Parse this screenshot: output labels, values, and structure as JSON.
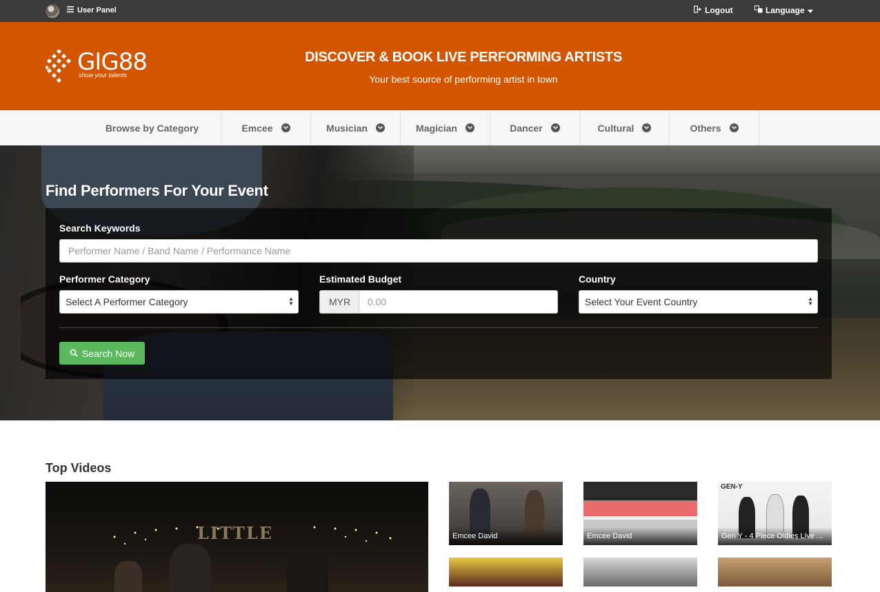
{
  "topbar": {
    "user_panel": "User Panel",
    "logout": "Logout",
    "language": "Language"
  },
  "header": {
    "logo_text": "GIG88",
    "logo_tagline": "show your talents",
    "title": "DISCOVER & BOOK LIVE PERFORMING ARTISTS",
    "subtitle": "Your best source of performing artist in town"
  },
  "nav": {
    "items": [
      {
        "label": "Browse by Category"
      },
      {
        "label": "Emcee"
      },
      {
        "label": "Musician"
      },
      {
        "label": "Magician"
      },
      {
        "label": "Dancer"
      },
      {
        "label": "Cultural"
      },
      {
        "label": "Others"
      }
    ]
  },
  "search": {
    "title": "Find Performers For Your Event",
    "keywords_label": "Search Keywords",
    "keywords_placeholder": "Performer Name / Band Name / Performance Name",
    "category_label": "Performer Category",
    "category_value": "Select A Performer Category",
    "budget_label": "Estimated Budget",
    "currency": "MYR",
    "budget_placeholder": "0.00",
    "country_label": "Country",
    "country_value": "Select Your Event Country",
    "button": "Search Now"
  },
  "videos": {
    "title": "Top Videos",
    "main_sign": "LITTLE",
    "thumbs": [
      {
        "caption": "Emcee David"
      },
      {
        "caption": "Emcee David"
      },
      {
        "caption": "Gen Y - 4 Piece Oldies Live ..."
      },
      {
        "caption": ""
      },
      {
        "caption": ""
      },
      {
        "caption": ""
      }
    ],
    "thumb_brand": "GEN-Y"
  },
  "colors": {
    "topbar": "#3b3b3b",
    "brand_orange": "#d45500",
    "nav_bg": "#f6f6f6",
    "search_button": "#5cb85c"
  }
}
